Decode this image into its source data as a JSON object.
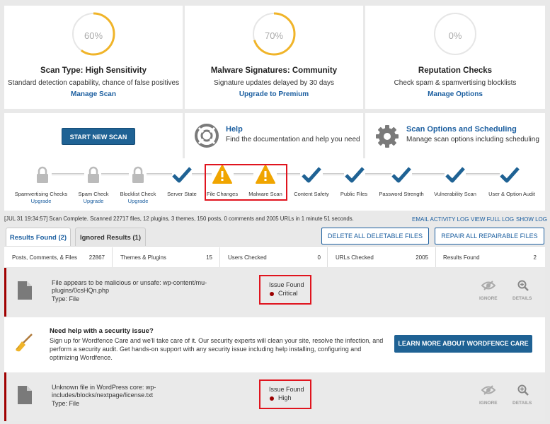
{
  "cards": [
    {
      "pct": "60%",
      "pct_value": 60,
      "title": "Scan Type: High Sensitivity",
      "desc": "Standard detection capability, chance of false positives",
      "link": "Manage Scan"
    },
    {
      "pct": "70%",
      "pct_value": 70,
      "title": "Malware Signatures: Community",
      "desc": "Signature updates delayed by 30 days",
      "link": "Upgrade to Premium"
    },
    {
      "pct": "0%",
      "pct_value": 0,
      "title": "Reputation Checks",
      "desc": "Check spam & spamvertising blocklists",
      "link": "Manage Options"
    }
  ],
  "start_scan_label": "START NEW SCAN",
  "help_panel": {
    "title": "Help",
    "desc": "Find the documentation and help you need"
  },
  "scan_options_panel": {
    "title": "Scan Options and Scheduling",
    "desc": "Manage scan options including scheduling"
  },
  "stages": [
    {
      "label": "Spamvertising Checks",
      "status": "locked",
      "upgrade": "Upgrade"
    },
    {
      "label": "Spam Check",
      "status": "locked",
      "upgrade": "Upgrade"
    },
    {
      "label": "Blocklist Check",
      "status": "locked",
      "upgrade": "Upgrade"
    },
    {
      "label": "Server State",
      "status": "ok"
    },
    {
      "label": "File Changes",
      "status": "warning"
    },
    {
      "label": "Malware Scan",
      "status": "warning"
    },
    {
      "label": "Content Safety",
      "status": "ok"
    },
    {
      "label": "Public Files",
      "status": "ok"
    },
    {
      "label": "Password Strength",
      "status": "ok"
    },
    {
      "label": "Vulnerability Scan",
      "status": "ok"
    },
    {
      "label": "User & Option Audit",
      "status": "ok"
    }
  ],
  "log": {
    "message": "[JUL 31 19:34:57] Scan Complete. Scanned 22717 files, 12 plugins, 3 themes, 150 posts, 0 comments and 2005 URLs in 1 minute 51 seconds.",
    "email_label": "EMAIL ACTIVITY LOG",
    "view_label": "VIEW FULL LOG",
    "show_label": "SHOW LOG"
  },
  "tabs": {
    "results": "Results Found (2)",
    "ignored": "Ignored Results (1)"
  },
  "actions": {
    "delete_all": "DELETE ALL DELETABLE FILES",
    "repair_all": "REPAIR ALL REPAIRABLE FILES"
  },
  "stats": [
    {
      "label": "Posts, Comments, & Files",
      "value": "22867"
    },
    {
      "label": "Themes & Plugins",
      "value": "15"
    },
    {
      "label": "Users Checked",
      "value": "0"
    },
    {
      "label": "URLs Checked",
      "value": "2005"
    },
    {
      "label": "Results Found",
      "value": "2"
    }
  ],
  "issues": [
    {
      "line1": "File appears to be malicious or unsafe: wp-content/mu-",
      "line2": "plugins/0csHQn.php",
      "type": "Type: File",
      "status": "Issue Found",
      "severity": "Critical",
      "ignore": "IGNORE",
      "details": "DETAILS"
    },
    {
      "line1": "Unknown file in WordPress core: wp-",
      "line2": "includes/blocks/nextpage/license.txt",
      "type": "Type: File",
      "status": "Issue Found",
      "severity": "High",
      "ignore": "IGNORE",
      "details": "DETAILS"
    }
  ],
  "help_block": {
    "title": "Need help with a security issue?",
    "desc": "Sign up for Wordfence Care and we'll take care of it. Our security experts will clean your site, resolve the infection, and perform a security audit. Get hands-on support with any security issue including help installing, configuring and optimizing Wordfence.",
    "button": "LEARN MORE ABOUT WORDFENCE CARE"
  },
  "colors": {
    "accent": "#1f6294",
    "gauge": "#f0b429",
    "check": "#1f6294",
    "warning": "#f0a500",
    "critical": "#9b0000"
  }
}
